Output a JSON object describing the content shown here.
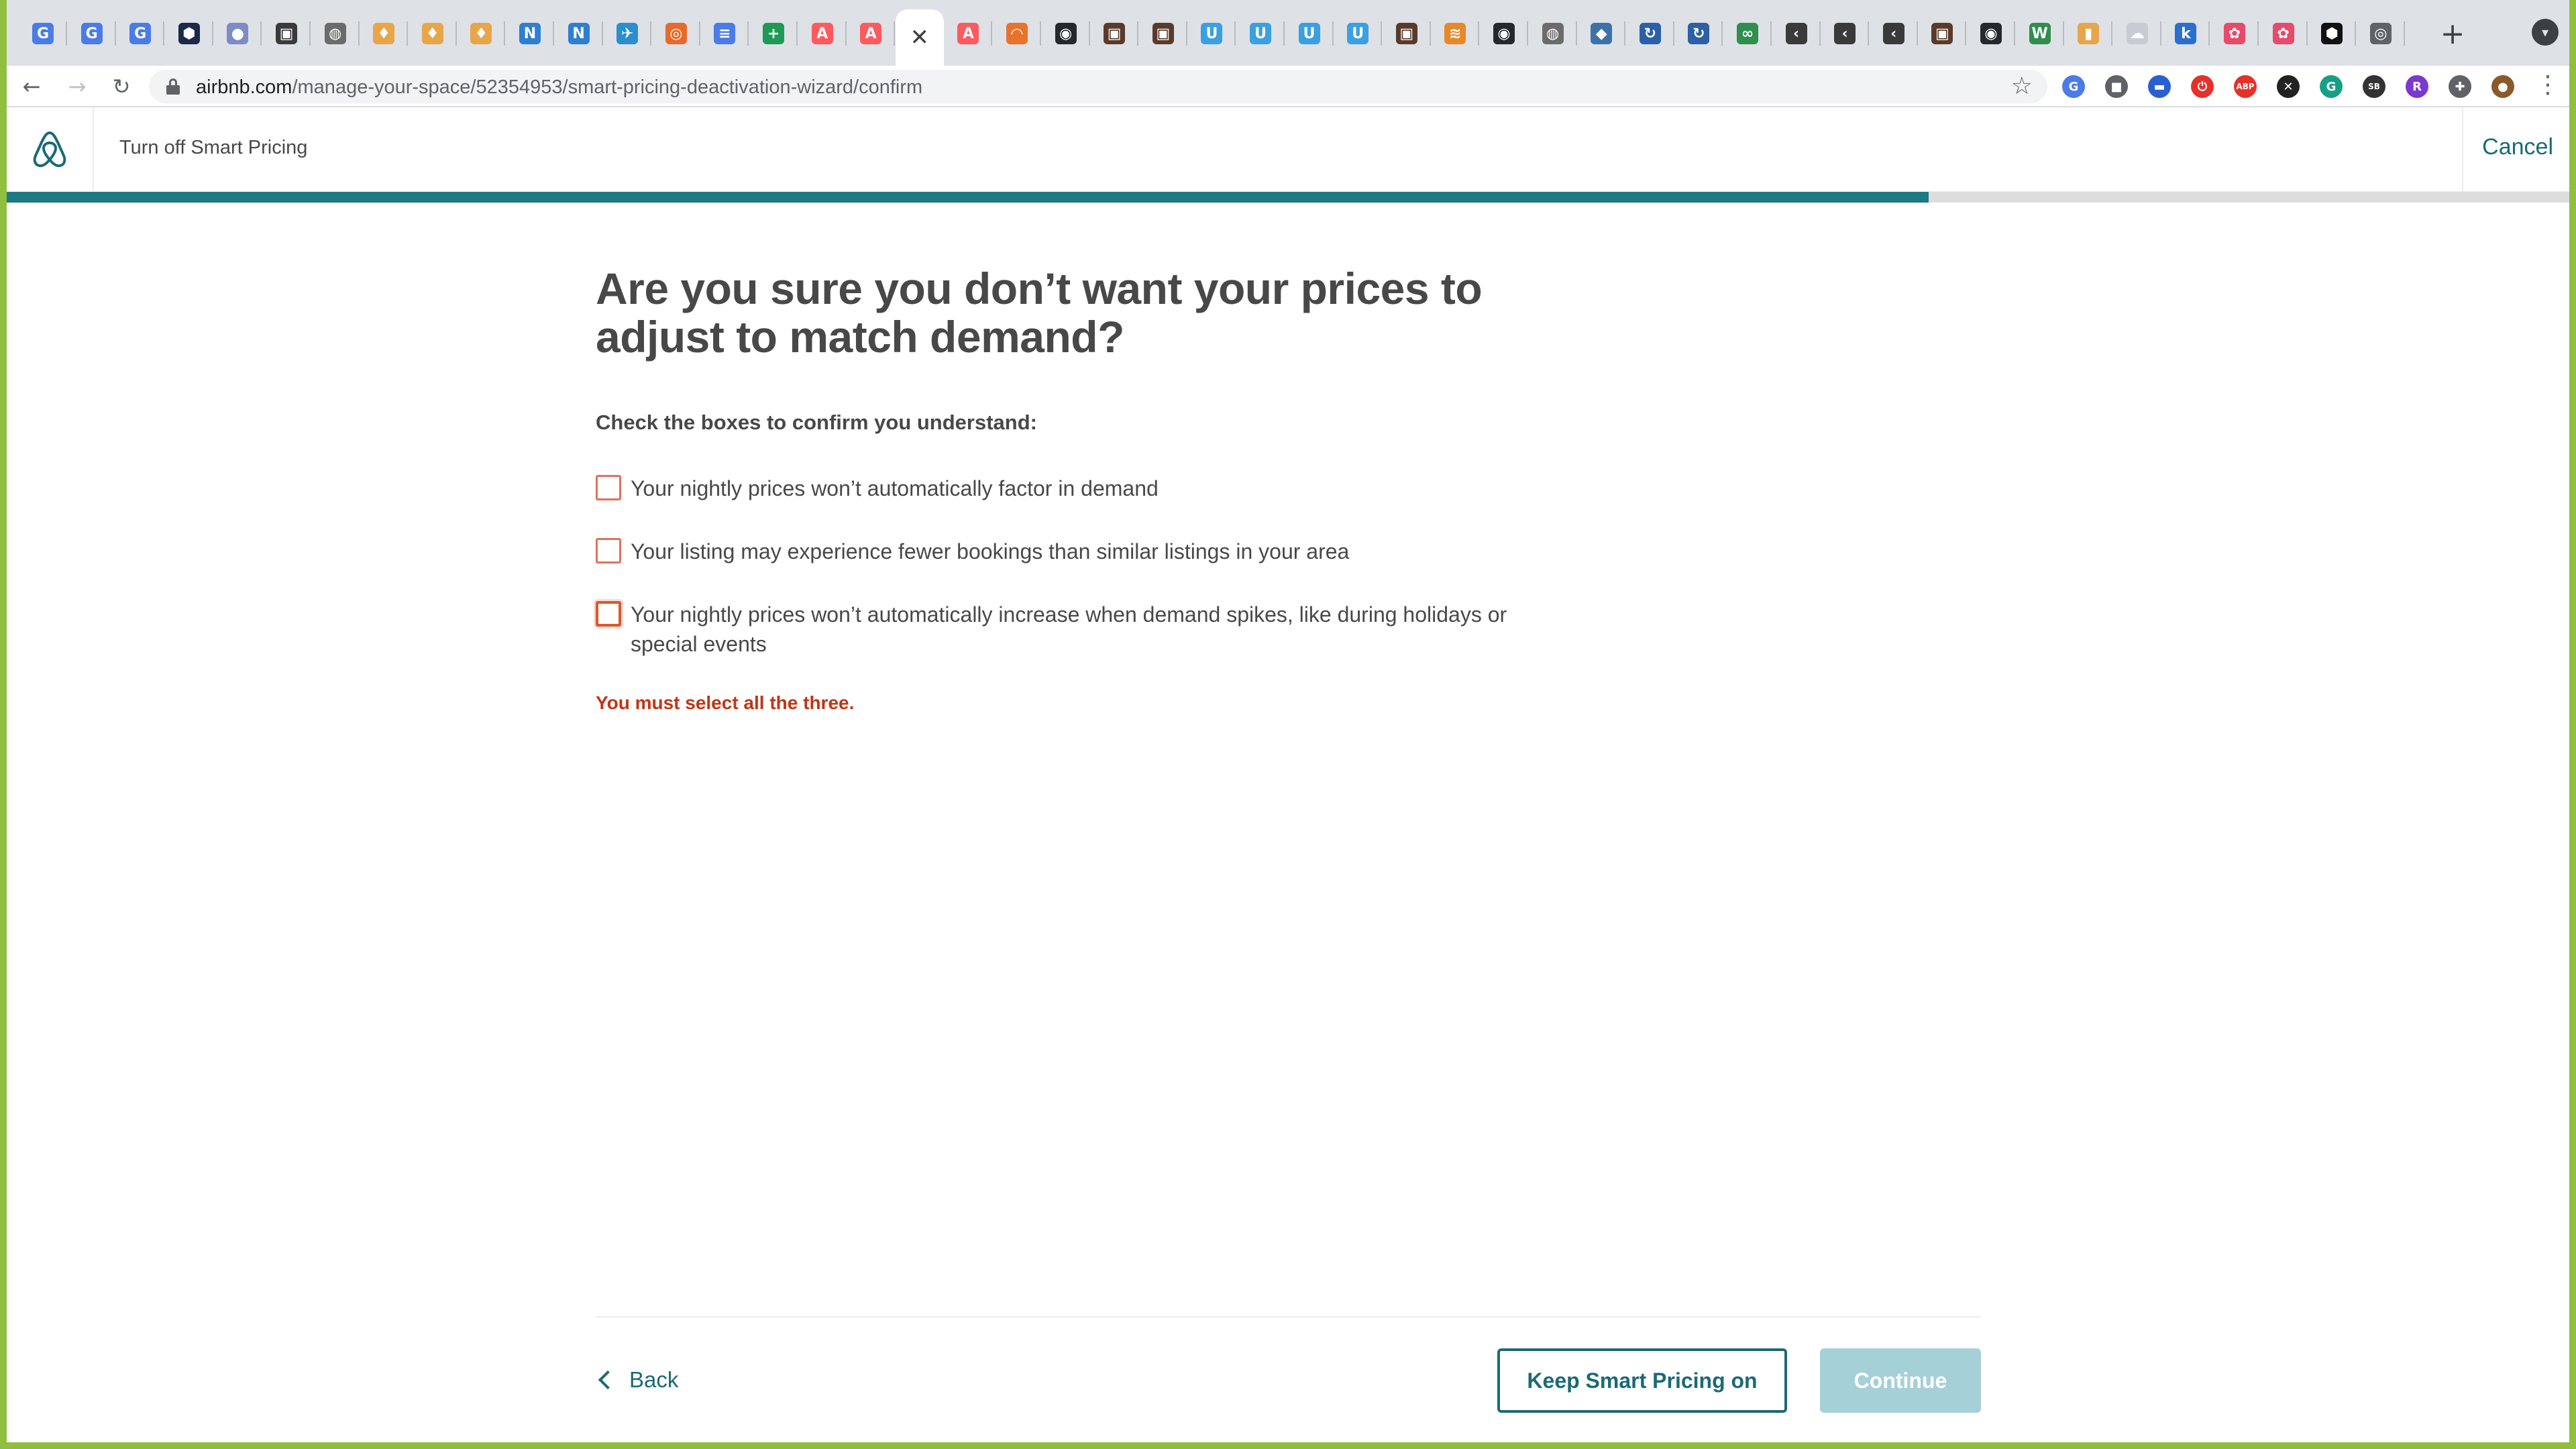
{
  "browser": {
    "tabs": [
      {
        "icon": "google-translate-icon",
        "glyph": "G",
        "color": "#4a7be8"
      },
      {
        "icon": "google-translate-icon",
        "glyph": "G",
        "color": "#4a7be8"
      },
      {
        "icon": "google-translate-icon",
        "glyph": "G",
        "color": "#4a7be8"
      },
      {
        "icon": "hexagon-app-icon",
        "glyph": "⬢",
        "color": "#1b2a4a"
      },
      {
        "icon": "circle-app-icon",
        "glyph": "●",
        "color": "#7d8cc4"
      },
      {
        "icon": "art-thumbnail-icon",
        "glyph": "▣",
        "color": "#3a3a3a"
      },
      {
        "icon": "globe-icon",
        "glyph": "◍",
        "color": "#6b6b6b"
      },
      {
        "icon": "shield-icon",
        "glyph": "♦",
        "color": "#e8a64a"
      },
      {
        "icon": "shield-icon",
        "glyph": "♦",
        "color": "#e8a64a"
      },
      {
        "icon": "shield-icon",
        "glyph": "♦",
        "color": "#e8a64a"
      },
      {
        "icon": "n-logo-icon",
        "glyph": "N",
        "color": "#2e7fd0"
      },
      {
        "icon": "n-logo-icon",
        "glyph": "N",
        "color": "#2e7fd0"
      },
      {
        "icon": "plane-icon",
        "glyph": "✈",
        "color": "#2a8fcf"
      },
      {
        "icon": "magnifier-icon",
        "glyph": "◎",
        "color": "#e86a2a"
      },
      {
        "icon": "google-docs-icon",
        "glyph": "≡",
        "color": "#4a7be8"
      },
      {
        "icon": "google-sheets-icon",
        "glyph": "+",
        "color": "#1e9a55"
      },
      {
        "icon": "airbnb-icon",
        "glyph": "A",
        "color": "#ff5a5f"
      },
      {
        "icon": "airbnb-icon",
        "glyph": "A",
        "color": "#ff5a5f"
      },
      {
        "icon": "close-icon",
        "glyph": "✕",
        "color": "#ffffff",
        "active": true
      },
      {
        "icon": "airbnb-icon",
        "glyph": "A",
        "color": "#ff5a5f"
      },
      {
        "icon": "arc-icon",
        "glyph": "◠",
        "color": "#e8732a"
      },
      {
        "icon": "github-icon",
        "glyph": "◉",
        "color": "#24292e"
      },
      {
        "icon": "art-thumbnail-icon",
        "glyph": "▣",
        "color": "#5a3a2a"
      },
      {
        "icon": "art-thumbnail-icon",
        "glyph": "▣",
        "color": "#5a3a2a"
      },
      {
        "icon": "u-logo-icon",
        "glyph": "U",
        "color": "#3aa0e0"
      },
      {
        "icon": "u-logo-icon",
        "glyph": "U",
        "color": "#3aa0e0"
      },
      {
        "icon": "u-logo-icon",
        "glyph": "U",
        "color": "#3aa0e0"
      },
      {
        "icon": "u-logo-icon",
        "glyph": "U",
        "color": "#3aa0e0"
      },
      {
        "icon": "art-thumbnail-icon",
        "glyph": "▣",
        "color": "#5a3a2a"
      },
      {
        "icon": "stack-icon",
        "glyph": "≋",
        "color": "#e8882a"
      },
      {
        "icon": "github-icon",
        "glyph": "◉",
        "color": "#24292e"
      },
      {
        "icon": "globe-icon",
        "glyph": "◍",
        "color": "#6b6b6b"
      },
      {
        "icon": "python-icon",
        "glyph": "◆",
        "color": "#3b73a8"
      },
      {
        "icon": "refresh-logo-icon",
        "glyph": "↻",
        "color": "#2b5fa8"
      },
      {
        "icon": "refresh-logo-icon",
        "glyph": "↻",
        "color": "#2b5fa8"
      },
      {
        "icon": "infinity-icon",
        "glyph": "∞",
        "color": "#2e8f4e"
      },
      {
        "icon": "lambda-icon",
        "glyph": "‹",
        "color": "#3a3a3a"
      },
      {
        "icon": "lambda-icon",
        "glyph": "‹",
        "color": "#3a3a3a"
      },
      {
        "icon": "lambda-icon",
        "glyph": "‹",
        "color": "#3a3a3a"
      },
      {
        "icon": "art-thumbnail-icon",
        "glyph": "▣",
        "color": "#5a3a2a"
      },
      {
        "icon": "github-icon",
        "glyph": "◉",
        "color": "#24292e"
      },
      {
        "icon": "w-logo-icon",
        "glyph": "W",
        "color": "#2e8f4e"
      },
      {
        "icon": "bar-chart-icon",
        "glyph": "▮",
        "color": "#e8a64a"
      },
      {
        "icon": "cloud-icon",
        "glyph": "☁",
        "color": "#c8ccd2"
      },
      {
        "icon": "k-logo-icon",
        "glyph": "k",
        "color": "#2a6fcf"
      },
      {
        "icon": "puzzle-logo-icon",
        "glyph": "✿",
        "color": "#e84a6a"
      },
      {
        "icon": "puzzle-logo-icon",
        "glyph": "✿",
        "color": "#e84a6a"
      },
      {
        "icon": "hexagon-app-icon",
        "glyph": "⬢",
        "color": "#111111"
      },
      {
        "icon": "chrome-icon",
        "glyph": "◎",
        "color": "#5f6368"
      }
    ],
    "address": {
      "domain": "airbnb.com",
      "path": "/manage-your-space/52354953/smart-pricing-deactivation-wizard/confirm"
    },
    "extensions": [
      {
        "icon": "translate-extension-icon",
        "glyph": "G",
        "color": "#4a7be8"
      },
      {
        "icon": "screenshot-extension-icon",
        "glyph": "■",
        "color": "#5f6368"
      },
      {
        "icon": "calendar-extension-icon",
        "glyph": "▬",
        "color": "#2a5fcf"
      },
      {
        "icon": "stop-extension-icon",
        "glyph": "⏻",
        "color": "#e8302a"
      },
      {
        "icon": "adblock-extension-icon",
        "glyph": "ABP",
        "color": "#e8302a"
      },
      {
        "icon": "x-extension-icon",
        "glyph": "✕",
        "color": "#222222"
      },
      {
        "icon": "grammarly-extension-icon",
        "glyph": "G",
        "color": "#15a086"
      },
      {
        "icon": "sb-extension-icon",
        "glyph": "SB",
        "color": "#333333"
      },
      {
        "icon": "r-extension-icon",
        "glyph": "R",
        "color": "#7a3ad0"
      },
      {
        "icon": "puzzle-extension-icon",
        "glyph": "✚",
        "color": "#5f6368"
      },
      {
        "icon": "profile-avatar-icon",
        "glyph": "●",
        "color": "#8a5a2a"
      }
    ]
  },
  "header": {
    "title": "Turn off Smart Pricing",
    "cancel_label": "Cancel"
  },
  "progress": {
    "fraction": 0.75
  },
  "main": {
    "heading": "Are you sure you don’t want your prices to adjust to match demand?",
    "subheading": "Check the boxes to confirm you understand:",
    "checkboxes": [
      {
        "label": "Your nightly prices won’t automatically factor in demand",
        "checked": false
      },
      {
        "label": "Your listing may experience fewer bookings than similar listings in your area",
        "checked": false
      },
      {
        "label": "Your nightly prices won’t automatically increase when demand spikes, like during holidays or special events",
        "checked": false
      }
    ],
    "error": "You must select all the three."
  },
  "footer": {
    "back_label": "Back",
    "keep_label": "Keep Smart Pricing on",
    "continue_label": "Continue"
  },
  "colors": {
    "brand_teal": "#1b6a76",
    "progress": "#1b7a83",
    "error": "#c13515",
    "checkbox_border": "#e0725a",
    "continue_disabled": "#a6d0d7"
  }
}
